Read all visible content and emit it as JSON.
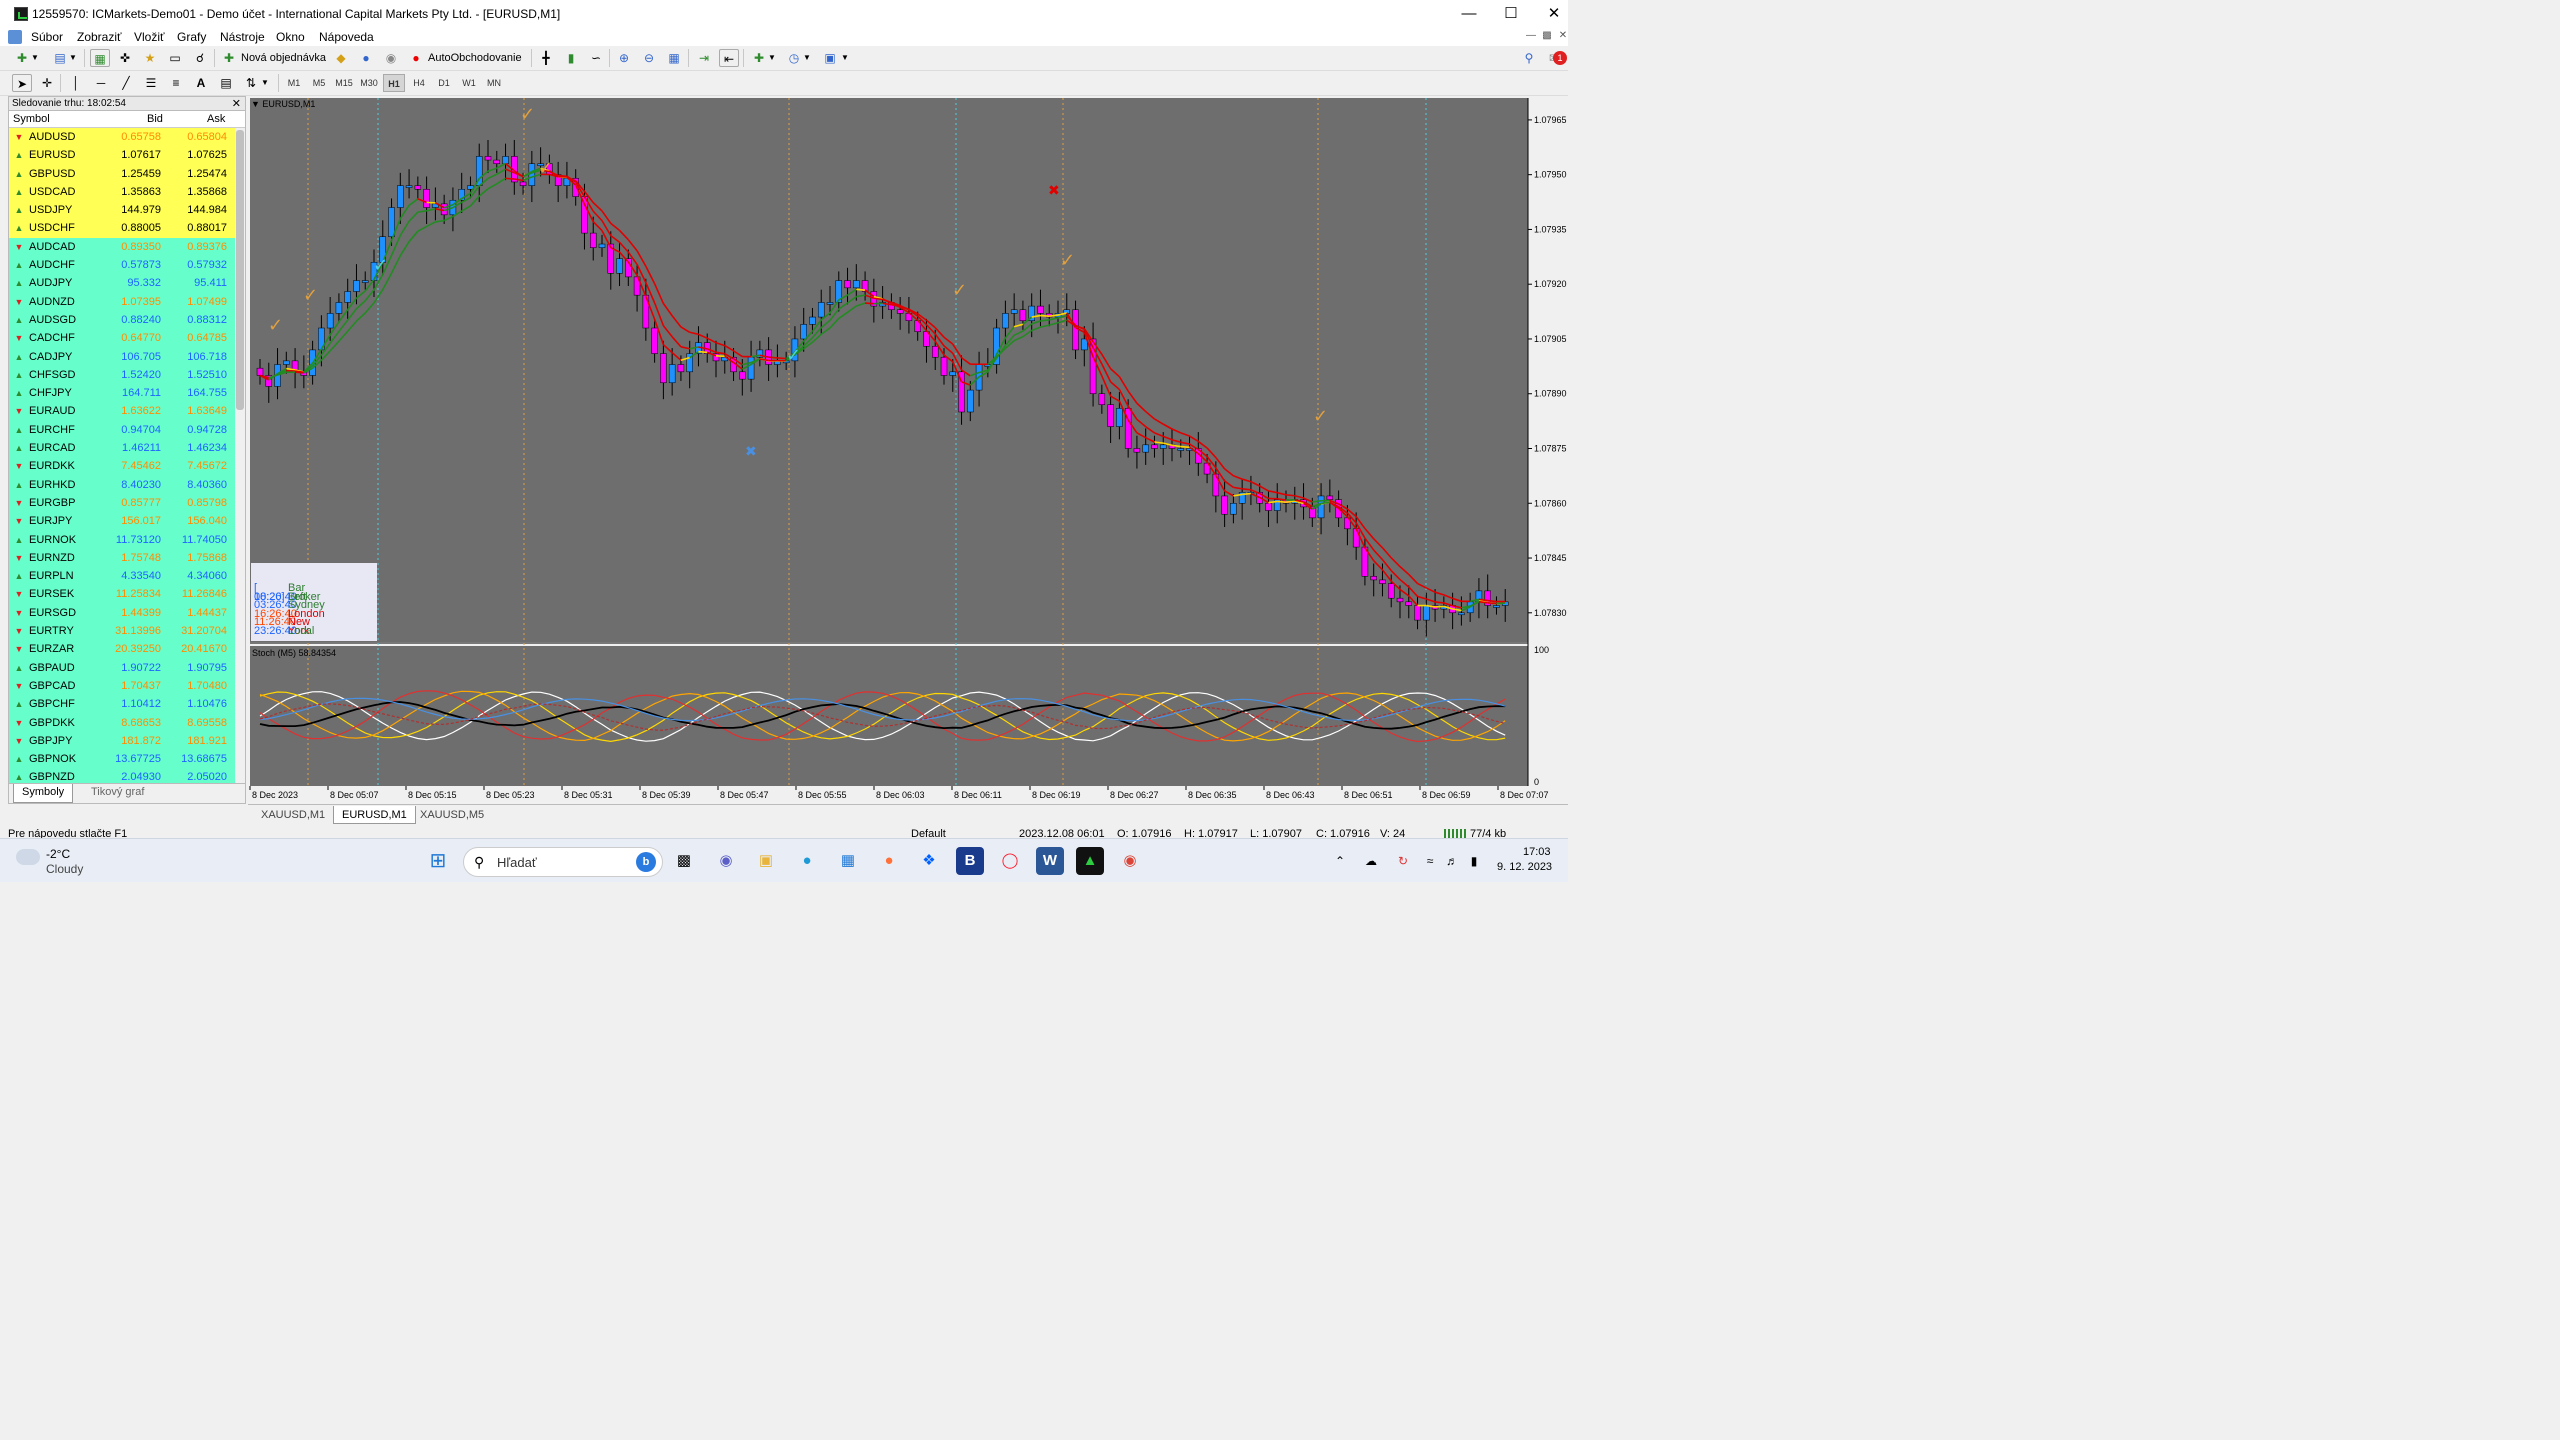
{
  "window": {
    "title": "12559570: ICMarkets-Demo01 - Demo účet - International Capital Markets Pty Ltd. - [EURUSD,M1]"
  },
  "menu": [
    "Súbor",
    "Zobraziť",
    "Vložiť",
    "Grafy",
    "Nástroje",
    "Okno",
    "Nápoveda"
  ],
  "toolbar": {
    "new_order": "Nová objednávka",
    "autotrading": "AutoObchodovanie",
    "timeframes": [
      "M1",
      "M5",
      "M15",
      "M30",
      "H1",
      "H4",
      "D1",
      "W1",
      "MN"
    ],
    "active_timeframe": "H1",
    "notifications": "1"
  },
  "market_watch": {
    "header": "Sledovanie trhu: 18:02:54",
    "col_symbol": "Symbol",
    "col_bid": "Bid",
    "col_ask": "Ask",
    "rows": [
      {
        "s": "AUDUSD",
        "b": "0.65758",
        "a": "0.65804",
        "bc": "#ff8c00",
        "ac": "#ff8c00",
        "g": "y",
        "d": "dn"
      },
      {
        "s": "EURUSD",
        "b": "1.07617",
        "a": "1.07625",
        "bc": "#000",
        "ac": "#000",
        "g": "y",
        "d": "up"
      },
      {
        "s": "GBPUSD",
        "b": "1.25459",
        "a": "1.25474",
        "bc": "#000",
        "ac": "#000",
        "g": "y",
        "d": "up"
      },
      {
        "s": "USDCAD",
        "b": "1.35863",
        "a": "1.35868",
        "bc": "#000",
        "ac": "#000",
        "g": "y",
        "d": "up"
      },
      {
        "s": "USDJPY",
        "b": "144.979",
        "a": "144.984",
        "bc": "#000",
        "ac": "#000",
        "g": "y",
        "d": "up"
      },
      {
        "s": "USDCHF",
        "b": "0.88005",
        "a": "0.88017",
        "bc": "#000",
        "ac": "#000",
        "g": "y",
        "d": "up"
      },
      {
        "s": "AUDCAD",
        "b": "0.89350",
        "a": "0.89376",
        "bc": "#ff8c00",
        "ac": "#ff8c00",
        "g": "c",
        "d": "dn"
      },
      {
        "s": "AUDCHF",
        "b": "0.57873",
        "a": "0.57932",
        "bc": "#1e64ff",
        "ac": "#1e64ff",
        "g": "c",
        "d": "up"
      },
      {
        "s": "AUDJPY",
        "b": "95.332",
        "a": "95.411",
        "bc": "#1e64ff",
        "ac": "#1e64ff",
        "g": "c",
        "d": "up"
      },
      {
        "s": "AUDNZD",
        "b": "1.07395",
        "a": "1.07499",
        "bc": "#ff8c00",
        "ac": "#ff8c00",
        "g": "c",
        "d": "dn"
      },
      {
        "s": "AUDSGD",
        "b": "0.88240",
        "a": "0.88312",
        "bc": "#1e64ff",
        "ac": "#1e64ff",
        "g": "c",
        "d": "up"
      },
      {
        "s": "CADCHF",
        "b": "0.64770",
        "a": "0.64785",
        "bc": "#ff8c00",
        "ac": "#ff8c00",
        "g": "c",
        "d": "dn"
      },
      {
        "s": "CADJPY",
        "b": "106.705",
        "a": "106.718",
        "bc": "#1e64ff",
        "ac": "#1e64ff",
        "g": "c",
        "d": "up"
      },
      {
        "s": "CHFSGD",
        "b": "1.52420",
        "a": "1.52510",
        "bc": "#1e64ff",
        "ac": "#1e64ff",
        "g": "c",
        "d": "up"
      },
      {
        "s": "CHFJPY",
        "b": "164.711",
        "a": "164.755",
        "bc": "#1e64ff",
        "ac": "#1e64ff",
        "g": "c",
        "d": "up"
      },
      {
        "s": "EURAUD",
        "b": "1.63622",
        "a": "1.63649",
        "bc": "#ff8c00",
        "ac": "#ff8c00",
        "g": "c",
        "d": "dn"
      },
      {
        "s": "EURCHF",
        "b": "0.94704",
        "a": "0.94728",
        "bc": "#1e64ff",
        "ac": "#1e64ff",
        "g": "c",
        "d": "up"
      },
      {
        "s": "EURCAD",
        "b": "1.46211",
        "a": "1.46234",
        "bc": "#1e64ff",
        "ac": "#1e64ff",
        "g": "c",
        "d": "up"
      },
      {
        "s": "EURDKK",
        "b": "7.45462",
        "a": "7.45672",
        "bc": "#ff8c00",
        "ac": "#ff8c00",
        "g": "c",
        "d": "dn"
      },
      {
        "s": "EURHKD",
        "b": "8.40230",
        "a": "8.40360",
        "bc": "#1e64ff",
        "ac": "#1e64ff",
        "g": "c",
        "d": "up"
      },
      {
        "s": "EURGBP",
        "b": "0.85777",
        "a": "0.85798",
        "bc": "#ff8c00",
        "ac": "#ff8c00",
        "g": "c",
        "d": "dn"
      },
      {
        "s": "EURJPY",
        "b": "156.017",
        "a": "156.040",
        "bc": "#ff8c00",
        "ac": "#ff8c00",
        "g": "c",
        "d": "dn"
      },
      {
        "s": "EURNOK",
        "b": "11.73120",
        "a": "11.74050",
        "bc": "#1e64ff",
        "ac": "#1e64ff",
        "g": "c",
        "d": "up"
      },
      {
        "s": "EURNZD",
        "b": "1.75748",
        "a": "1.75868",
        "bc": "#ff8c00",
        "ac": "#ff8c00",
        "g": "c",
        "d": "dn"
      },
      {
        "s": "EURPLN",
        "b": "4.33540",
        "a": "4.34060",
        "bc": "#1e64ff",
        "ac": "#1e64ff",
        "g": "c",
        "d": "up"
      },
      {
        "s": "EURSEK",
        "b": "11.25834",
        "a": "11.26846",
        "bc": "#ff8c00",
        "ac": "#ff8c00",
        "g": "c",
        "d": "dn"
      },
      {
        "s": "EURSGD",
        "b": "1.44399",
        "a": "1.44437",
        "bc": "#ff8c00",
        "ac": "#ff8c00",
        "g": "c",
        "d": "dn"
      },
      {
        "s": "EURTRY",
        "b": "31.13996",
        "a": "31.20704",
        "bc": "#ff8c00",
        "ac": "#ff8c00",
        "g": "c",
        "d": "dn"
      },
      {
        "s": "EURZAR",
        "b": "20.39250",
        "a": "20.41670",
        "bc": "#ff8c00",
        "ac": "#ff8c00",
        "g": "c",
        "d": "dn"
      },
      {
        "s": "GBPAUD",
        "b": "1.90722",
        "a": "1.90795",
        "bc": "#1e64ff",
        "ac": "#1e64ff",
        "g": "c",
        "d": "up"
      },
      {
        "s": "GBPCAD",
        "b": "1.70437",
        "a": "1.70480",
        "bc": "#ff8c00",
        "ac": "#ff8c00",
        "g": "c",
        "d": "dn"
      },
      {
        "s": "GBPCHF",
        "b": "1.10412",
        "a": "1.10476",
        "bc": "#1e64ff",
        "ac": "#1e64ff",
        "g": "c",
        "d": "up"
      },
      {
        "s": "GBPDKK",
        "b": "8.68653",
        "a": "8.69558",
        "bc": "#ff8c00",
        "ac": "#ff8c00",
        "g": "c",
        "d": "dn"
      },
      {
        "s": "GBPJPY",
        "b": "181.872",
        "a": "181.921",
        "bc": "#ff8c00",
        "ac": "#ff8c00",
        "g": "c",
        "d": "dn"
      },
      {
        "s": "GBPNOK",
        "b": "13.67725",
        "a": "13.68675",
        "bc": "#1e64ff",
        "ac": "#1e64ff",
        "g": "c",
        "d": "up"
      },
      {
        "s": "GBPNZD",
        "b": "2.04930",
        "a": "2.05020",
        "bc": "#1e64ff",
        "ac": "#1e64ff",
        "g": "c",
        "d": "up"
      }
    ],
    "tabs": [
      "Symboly",
      "Tikový graf"
    ]
  },
  "chart": {
    "label": "EURUSD,M1",
    "stoch_label": "Stoch (M5) 58.84354",
    "price_ticks": [
      "1.07965",
      "1.07950",
      "1.07935",
      "1.07920",
      "1.07905",
      "1.07890",
      "1.07875",
      "1.07860",
      "1.07845",
      "1.07830"
    ],
    "time_ticks": [
      "8 Dec 2023",
      "8 Dec 05:07",
      "8 Dec 05:15",
      "8 Dec 05:23",
      "8 Dec 05:31",
      "8 Dec 05:39",
      "8 Dec 05:47",
      "8 Dec 05:55",
      "8 Dec 06:03",
      "8 Dec 06:11",
      "8 Dec 06:19",
      "8 Dec 06:27",
      "8 Dec 06:35",
      "8 Dec 06:43",
      "8 Dec 06:51",
      "8 Dec 06:59",
      "8 Dec 07:07"
    ],
    "stoch_ticks": [
      "100",
      "0"
    ],
    "sessions": [
      {
        "time": "[ 00:20]",
        "name": "Bar Left",
        "tc": "#1e64ff",
        "nc": "#2e7d32"
      },
      {
        "time": "18:26:40",
        "name": "Broker",
        "tc": "#1e64ff",
        "nc": "#2e7d32"
      },
      {
        "time": "03:26:40",
        "name": "Sydney",
        "tc": "#1e64ff",
        "nc": "#2e7d32"
      },
      {
        "time": "16:26:40",
        "name": "London",
        "tc": "#ff4500",
        "nc": "#e00000"
      },
      {
        "time": "11:26:40",
        "name": "New York",
        "tc": "#ff4500",
        "nc": "#e00000"
      },
      {
        "time": "23:26:40",
        "name": "Local",
        "tc": "#1e64ff",
        "nc": "#2e7d32"
      }
    ],
    "tabs": [
      "XAUUSD,M1",
      "EURUSD,M1",
      "XAUUSD,M5"
    ],
    "active_tab": "EURUSD,M1",
    "colors": {
      "bg": "#6e6e6e",
      "bull": "#1e90ff",
      "bear": "#ff00ff",
      "ma_up": "#228b22",
      "ma_dn": "#e00000",
      "ma_flat": "#ffd700"
    }
  },
  "chart_data": {
    "type": "candlestick",
    "symbol": "EURUSD",
    "timeframe": "M1",
    "ylim": [
      1.07822,
      1.07971
    ],
    "close": [
      1.07895,
      1.07892,
      1.07898,
      1.07899,
      1.07896,
      1.07895,
      1.07902,
      1.07908,
      1.07912,
      1.07915,
      1.07918,
      1.07921,
      1.07921,
      1.07926,
      1.07933,
      1.07941,
      1.07947,
      1.07947,
      1.07946,
      1.07941,
      1.07942,
      1.07939,
      1.07943,
      1.07946,
      1.07947,
      1.07955,
      1.07954,
      1.07953,
      1.07955,
      1.07948,
      1.07947,
      1.07953,
      1.07953,
      1.0795,
      1.07947,
      1.07949,
      1.07944,
      1.07934,
      1.0793,
      1.07931,
      1.07923,
      1.07927,
      1.07922,
      1.07917,
      1.07908,
      1.07901,
      1.07893,
      1.07898,
      1.07896,
      1.07901,
      1.07904,
      1.07901,
      1.07899,
      1.079,
      1.07896,
      1.07894,
      1.079,
      1.07902,
      1.07898,
      1.07899,
      1.07899,
      1.07905,
      1.07909,
      1.07911,
      1.07915,
      1.07915,
      1.07921,
      1.07919,
      1.07921,
      1.07918,
      1.07914,
      1.07915,
      1.07913,
      1.07912,
      1.0791,
      1.07907,
      1.07903,
      1.079,
      1.07895,
      1.07896,
      1.07885,
      1.07891,
      1.07898,
      1.07898,
      1.07908,
      1.07912,
      1.07913,
      1.0791,
      1.07914,
      1.07912,
      1.07911,
      1.07912,
      1.07913,
      1.07902,
      1.07905,
      1.0789,
      1.07887,
      1.07881,
      1.07886,
      1.07875,
      1.07874,
      1.07876,
      1.07875,
      1.07876,
      1.07875,
      1.07875,
      1.07875,
      1.07871,
      1.07868,
      1.07862,
      1.07857,
      1.0786,
      1.07863,
      1.07863,
      1.0786,
      1.07858,
      1.07861,
      1.0786,
      1.07861,
      1.07859,
      1.07856,
      1.07862,
      1.07861,
      1.07856,
      1.07853,
      1.07848,
      1.0784,
      1.07839,
      1.07838,
      1.07834,
      1.07833,
      1.07832,
      1.07828,
      1.07832,
      1.07831,
      1.07832,
      1.0783,
      1.0783,
      1.07833,
      1.07836,
      1.07832,
      1.07832,
      1.07833
    ],
    "stoch": {
      "ylim": [
        0,
        100
      ],
      "series": [
        {
          "name": "Stoch (M5)",
          "last": 58.84354
        }
      ]
    }
  },
  "status": {
    "help": "Pre nápovedu stlačte F1",
    "profile": "Default",
    "datetime": "2023.12.08 06:01",
    "o": "O: 1.07916",
    "h": "H: 1.07917",
    "l": "L: 1.07907",
    "c": "C: 1.07916",
    "v": "V: 24",
    "net": "77/4 kb"
  },
  "taskbar": {
    "temp": "-2°C",
    "weather": "Cloudy",
    "search": "Hľadať",
    "time": "17:03",
    "date": "9. 12. 2023"
  }
}
